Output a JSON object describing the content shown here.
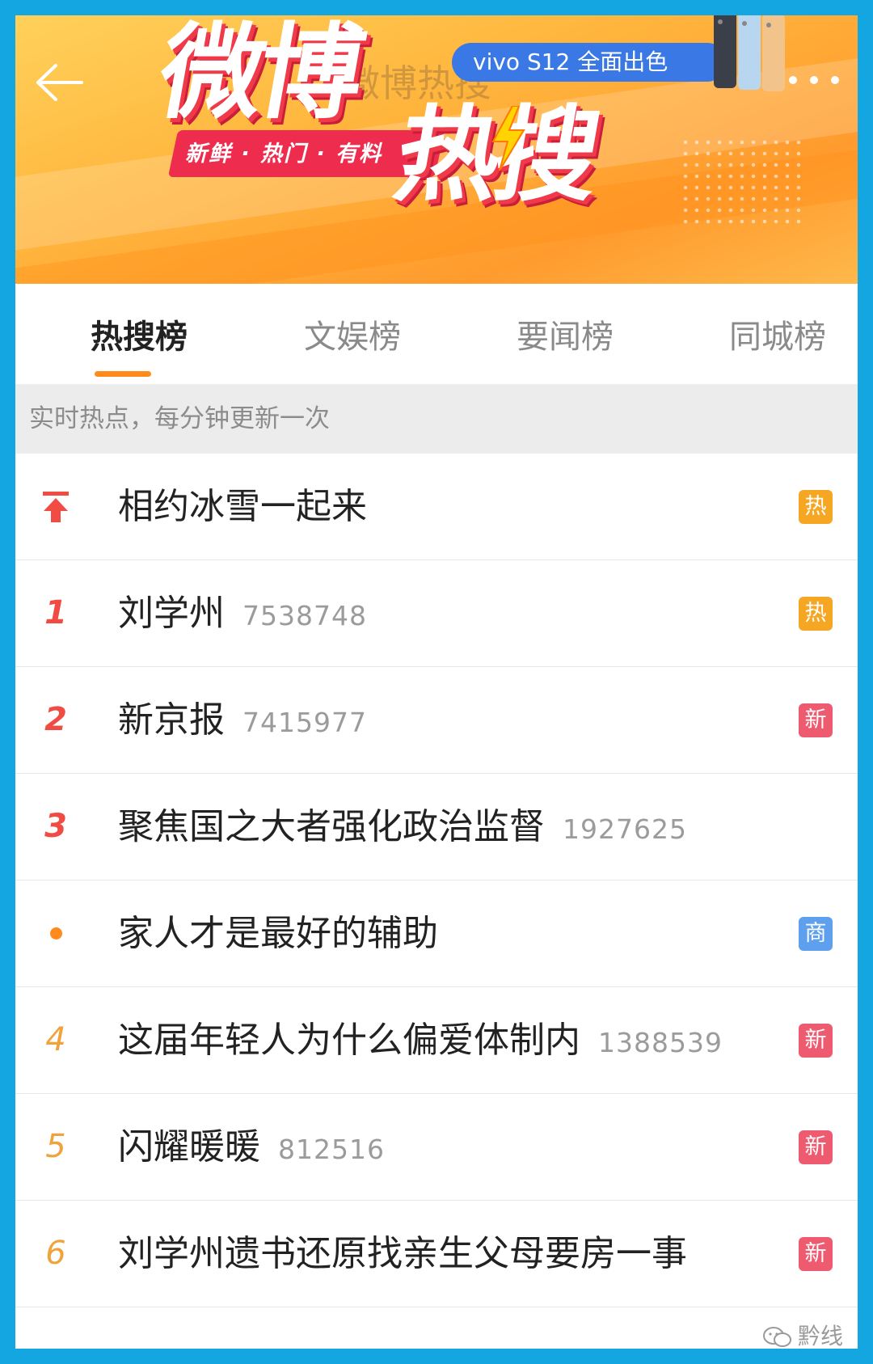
{
  "banner": {
    "logo_line1": "微博",
    "logo_line2": "热搜",
    "slogan": "新鲜 · 热门 · 有料",
    "ghost_title": "微博热搜",
    "ad_text": "vivo S12 全面出色",
    "back_icon": "back-arrow-icon",
    "more_icon": "more-dots-icon"
  },
  "tabs": [
    {
      "label": "热搜榜",
      "active": true
    },
    {
      "label": "文娱榜",
      "active": false
    },
    {
      "label": "要闻榜",
      "active": false
    },
    {
      "label": "同城榜",
      "active": false
    }
  ],
  "subheader": "实时热点，每分钟更新一次",
  "list": [
    {
      "rank": "",
      "rank_icon": "pin-top-icon",
      "title": "相约冰雪一起来",
      "count": "",
      "badge": "热",
      "badge_type": "hot"
    },
    {
      "rank": "1",
      "title": "刘学州",
      "count": "7538748",
      "badge": "热",
      "badge_type": "hot"
    },
    {
      "rank": "2",
      "title": "新京报",
      "count": "7415977",
      "badge": "新",
      "badge_type": "new"
    },
    {
      "rank": "3",
      "title": "聚焦国之大者强化政治监督",
      "count": "1927625",
      "badge": "",
      "badge_type": ""
    },
    {
      "rank": "",
      "rank_icon": "ad-dot-icon",
      "title": "家人才是最好的辅助",
      "count": "",
      "badge": "商",
      "badge_type": "biz"
    },
    {
      "rank": "4",
      "title": "这届年轻人为什么偏爱体制内",
      "count": "1388539",
      "badge": "新",
      "badge_type": "new"
    },
    {
      "rank": "5",
      "title": "闪耀暖暖",
      "count": "812516",
      "badge": "新",
      "badge_type": "new"
    },
    {
      "rank": "6",
      "title": "刘学州遗书还原找亲生父母要房一事",
      "count": "",
      "badge": "新",
      "badge_type": "new"
    }
  ],
  "watermark": "黔线",
  "colors": {
    "frame_border": "#14a6e0",
    "tab_accent": "#ff8c1a",
    "rank_top": "#f04c44",
    "rank_other": "#f0a23c",
    "badge_hot": "#f5a623",
    "badge_new": "#ee5a6f",
    "badge_biz": "#5ea0ee"
  }
}
